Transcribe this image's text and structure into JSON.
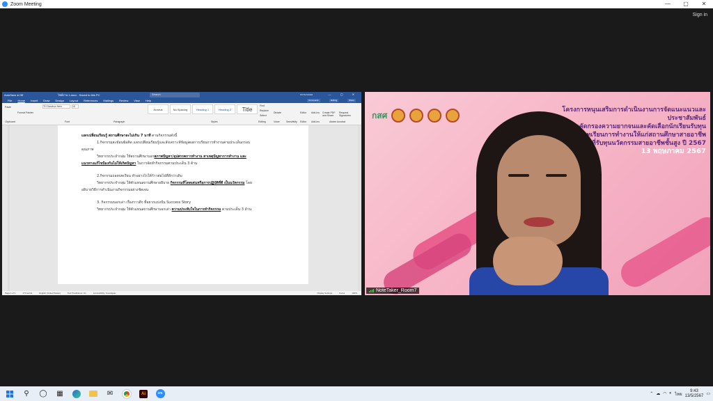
{
  "window": {
    "title": "Zoom Meeting",
    "controls": [
      "—",
      "▢",
      "✕"
    ]
  },
  "signin": "Sign in",
  "word": {
    "titlebar_left": "AutoSave ● Off",
    "doc_title": "ไฟล์งาน 1.docx - Saved to this PC",
    "search_placeholder": "Search",
    "user": "NOTETAKER",
    "menu": [
      "File",
      "Home",
      "Insert",
      "Draw",
      "Design",
      "Layout",
      "References",
      "Mailings",
      "Review",
      "View",
      "Help"
    ],
    "menu_buttons": [
      "Comments",
      "Editing",
      "Share"
    ],
    "ribbon": {
      "paste": "Paste",
      "font": "TH Sarabun New",
      "font_size": "16",
      "format_painter": "Format Painter",
      "groups": [
        "Clipboard",
        "Font",
        "Paragraph",
        "Styles",
        "Editing",
        "Voice",
        "Sensitivity",
        "Editor",
        "Add-ins",
        "Adobe Acrobat"
      ],
      "styles": [
        "Normal",
        "No Spacing",
        "Heading 1",
        "Heading 2",
        "Title"
      ],
      "find": "Find",
      "replace": "Replace",
      "select": "Select",
      "dictate": "Dictate",
      "editor": "Editor",
      "addins": "Add-ins",
      "pdf1": "Create PDF and Share",
      "pdf2": "Request Signatures"
    },
    "doc": {
      "heading_b": "แลกเปลี่ยนเรียนรู้ สถานศึกษาละไม่เกิน 7 นาที",
      "heading_rest": " ตามกิจกรรมดังนี้",
      "p1": "1.กิจกรรมสะท้อนข้อคิด แลกเปลี่ยนเรียนรู้และสังเคราะห์ข้อมูลผลการเรียนการทำงานตามประเด็นกรอบ",
      "p1b": "คุณภาพ",
      "p2a": "วิทยากรประจำกลุ่ม ให้สถานศึกษาบอก",
      "p2u": "สภาพปัญหา/อุปสรรคการทำงาน สาเหตุปัญหาการทำงาน และ",
      "p2u2": "แนวทางแก้ไขป้องกันไม่ให้เกิดปัญหา",
      "p2c": " ในการจัดทำกิจกรรมตามประเด็น 3 ด้าน",
      "p3": "2.กิจกรรมถอดบทเรียน ทำอย่างไรให้ก้าวต่อไปที่ดีกว่าเดิม",
      "p4a": "วิทยากรประจำกลุ่ม ให้ตัวแทนสถานศึกษาอธิบาย ",
      "p4u": "กิจกรรมที่โดดเด่นหรือการปฏิบัติที่ดี เป็นนวัตกรรม",
      "p4c": " โดย",
      "p4d": "อธิบายวิธีการดำเนินงานกิจกรรมอย่างชัดเจน",
      "p5": "3. กิจกรรมบอกเล่า เรื่องราวดีๆ ที่อยากแบ่งปัน Success Story",
      "p6a": "วิทยากรประจำกลุ่ม ให้ตัวแทนสถานศึกษาบอกเล่า ",
      "p6u": "ความประทับใจในการทำกิจกรรม",
      "p6c": " ตามประเด็น 3 ด้าน"
    },
    "status": [
      "Page 1 of 1",
      "170 words",
      "English (United States)",
      "Text Predictions: On",
      "Accessibility: Investigate",
      "Display Settings",
      "Focus"
    ],
    "zoom": "100%"
  },
  "video": {
    "logo": "กสศ",
    "banner_lines": [
      "โครงการหนุนเสริมการดำเนินงานการจัดแนะแนวและประชาสัมพันธ์",
      "การค้นหาคัดกรองความยากจนและคัดเลือกนักเรียนรับทุน",
      "และถอดบทเรียนการทำงานให้แก่สถานศึกษาสายอาชีพ",
      "ที่รับทุนนวัตกรรมสายอาชีพชั้นสูง ปี 2567"
    ],
    "date": "13 พฤษภาคม 2567",
    "participant": "NoteTaker_Room7"
  },
  "taskbar": {
    "icons": [
      "windows-icon",
      "search-icon",
      "task-view-icon",
      "widgets-icon",
      "edge-icon",
      "explorer-icon",
      "mail-icon",
      "chrome-icon",
      "illustrator-icon",
      "zoom-icon"
    ],
    "lang": "ไทย",
    "time": "9:43",
    "date": "13/5/2567"
  }
}
